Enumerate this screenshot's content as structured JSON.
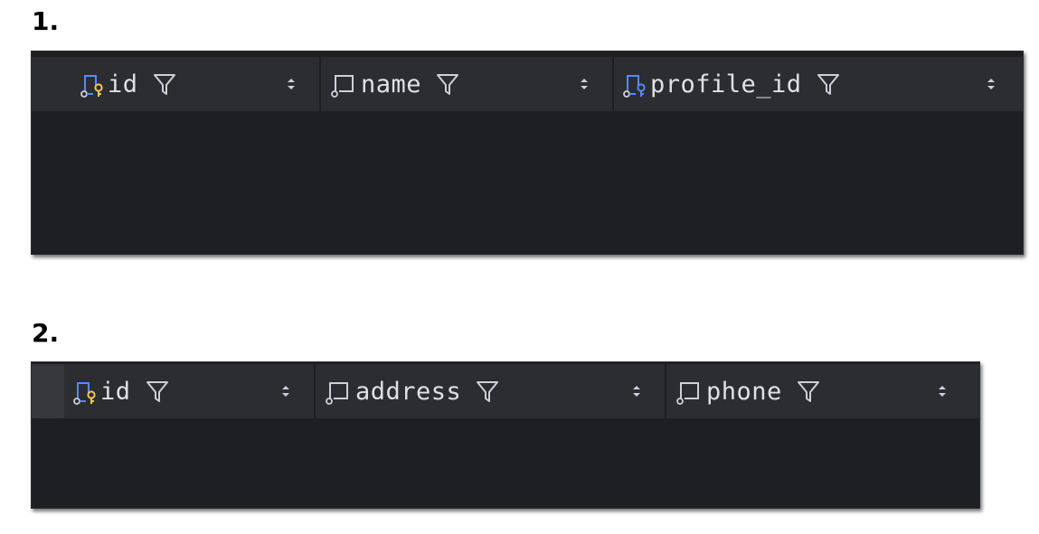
{
  "sections": [
    {
      "label": "1.",
      "columns": [
        {
          "name": "id",
          "icon": "primary-key-column-icon"
        },
        {
          "name": "name",
          "icon": "column-icon"
        },
        {
          "name": "profile_id",
          "icon": "foreign-key-column-icon"
        }
      ]
    },
    {
      "label": "2.",
      "columns": [
        {
          "name": "id",
          "icon": "primary-key-column-icon"
        },
        {
          "name": "address",
          "icon": "column-icon"
        },
        {
          "name": "phone",
          "icon": "column-icon"
        }
      ]
    }
  ],
  "colors": {
    "panel_bg": "#1e1f22",
    "header_bg": "#2b2d30",
    "text": "#dfe1e5",
    "icon_gray": "#ced0d6",
    "icon_blue": "#548af7",
    "key_gold": "#f2c55c"
  }
}
